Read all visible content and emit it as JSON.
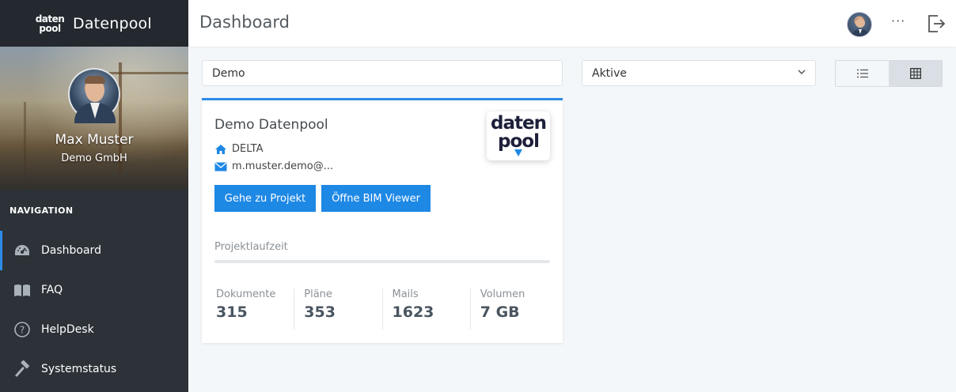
{
  "brand": {
    "logo_line1": "daten",
    "logo_line2": "pool",
    "name": "Datenpool"
  },
  "profile": {
    "user_name": "Max Muster",
    "company": "Demo GmbH"
  },
  "navigation": {
    "heading": "NAVIGATION",
    "items": [
      {
        "label": "Dashboard",
        "icon": "gauge-icon",
        "active": true
      },
      {
        "label": "FAQ",
        "icon": "book-icon",
        "active": false
      },
      {
        "label": "HelpDesk",
        "icon": "question-circle-icon",
        "active": false
      },
      {
        "label": "Systemstatus",
        "icon": "hammer-icon",
        "active": false
      }
    ]
  },
  "header": {
    "title": "Dashboard",
    "menu_glyph": "···"
  },
  "filters": {
    "search_value": "Demo",
    "status_selected": "Aktive",
    "view_mode": "grid"
  },
  "project": {
    "title": "Demo Datenpool",
    "location": "DELTA",
    "email": "m.muster.demo@...",
    "logo_line1": "daten",
    "logo_line2": "pool",
    "buttons": {
      "goto_project": "Gehe zu Projekt",
      "open_bim": "Öffne BIM Viewer"
    },
    "runtime_label": "Projektlaufzeit",
    "runtime_progress": 0,
    "stats": [
      {
        "label": "Dokumente",
        "value": "315"
      },
      {
        "label": "Pläne",
        "value": "353"
      },
      {
        "label": "Mails",
        "value": "1623"
      },
      {
        "label": "Volumen",
        "value": "7 GB"
      }
    ]
  },
  "colors": {
    "accent": "#1e88e5",
    "sidebar": "#2c3237",
    "sidebar_header": "#23292e"
  }
}
